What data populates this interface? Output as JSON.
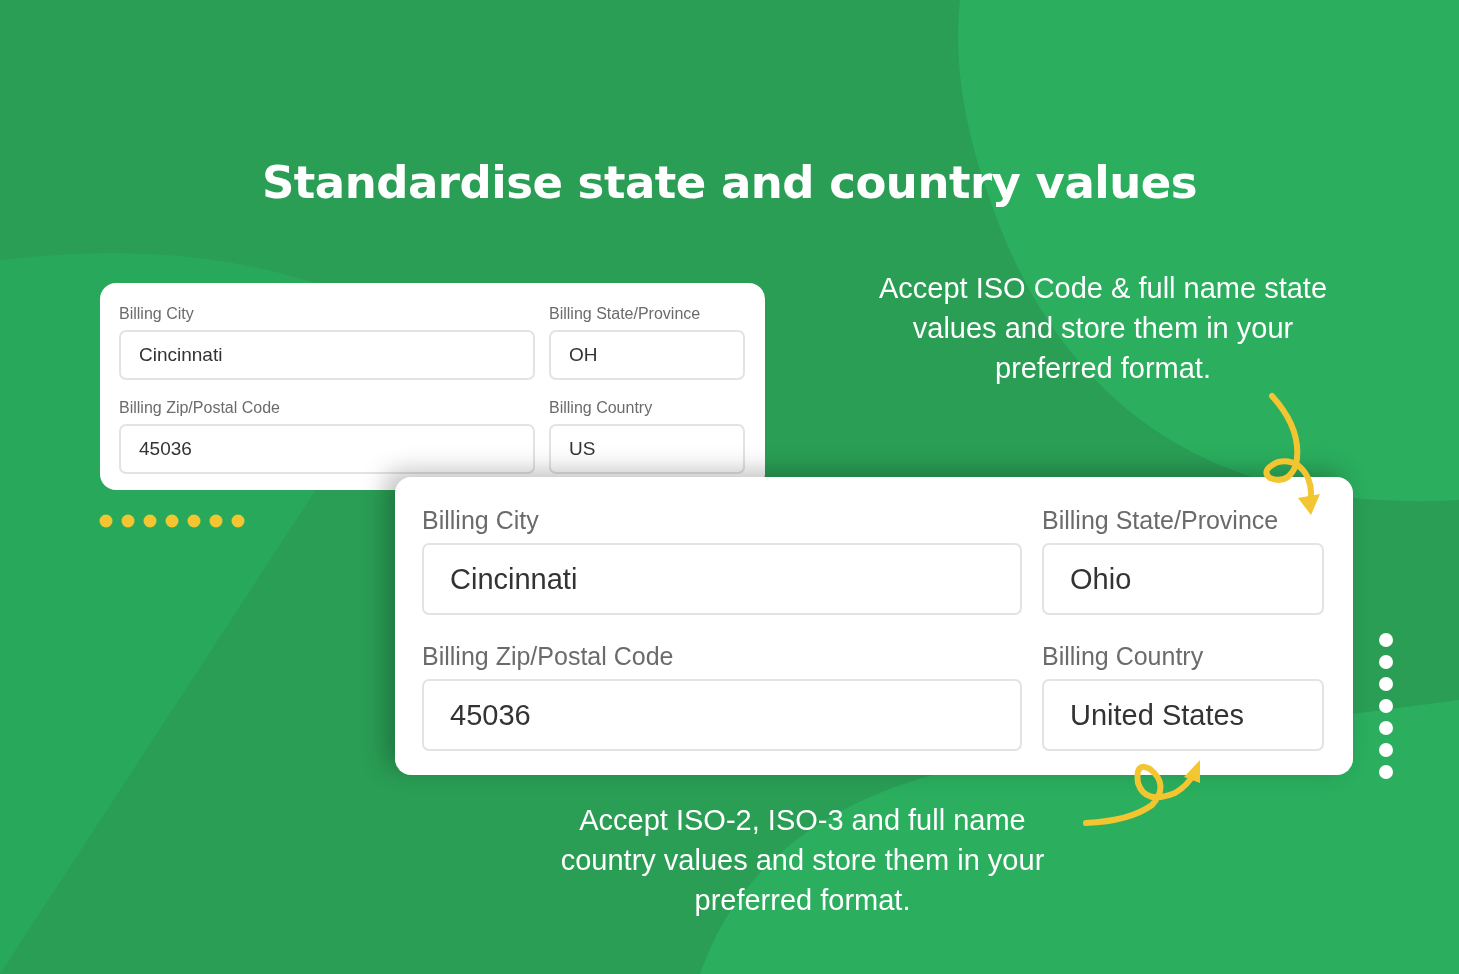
{
  "title": "Standardise state and country values",
  "forms": [
    {
      "fields": [
        {
          "label": "Billing City",
          "value": "Cincinnati"
        },
        {
          "label": "Billing State/Province",
          "value": "OH"
        },
        {
          "label": "Billing Zip/Postal Code",
          "value": "45036"
        },
        {
          "label": "Billing Country",
          "value": "US"
        }
      ]
    },
    {
      "fields": [
        {
          "label": "Billing City",
          "value": "Cincinnati"
        },
        {
          "label": "Billing State/Province",
          "value": "Ohio"
        },
        {
          "label": "Billing Zip/Postal Code",
          "value": "45036"
        },
        {
          "label": "Billing Country",
          "value": "United States"
        }
      ]
    }
  ],
  "notes": [
    "Accept ISO Code & full name state values and store them in your preferred format.",
    "Accept ISO-2, ISO-3 and full name country values and store them in your preferred format."
  ]
}
